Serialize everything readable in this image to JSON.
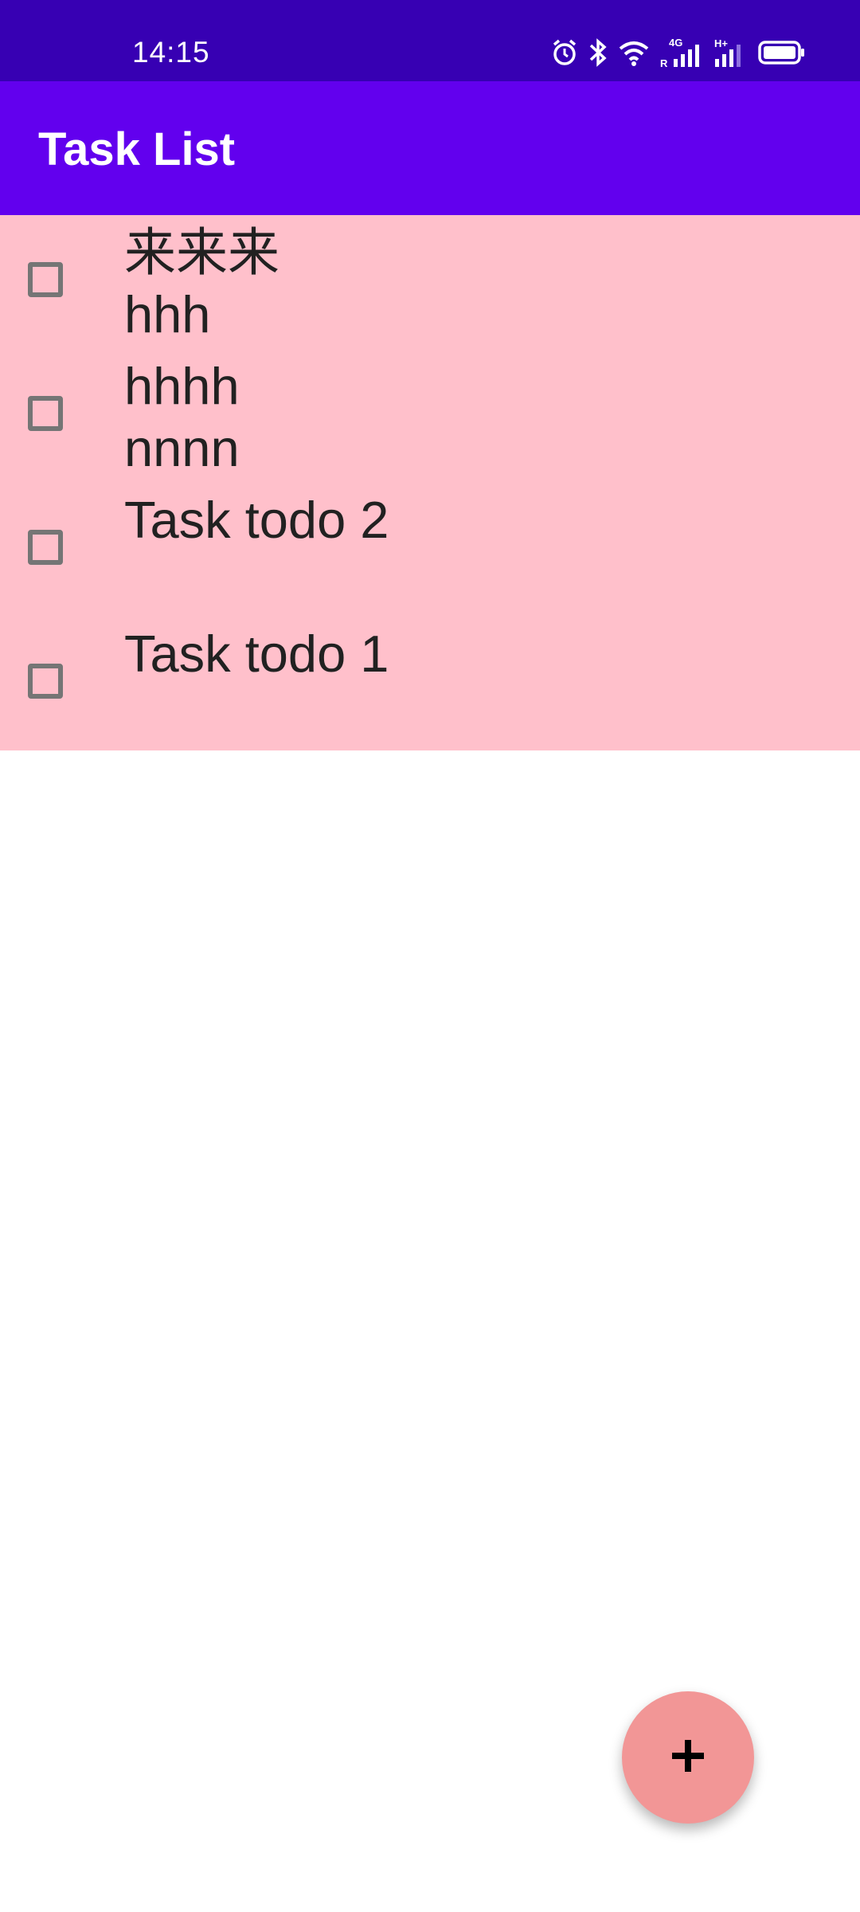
{
  "status_bar": {
    "time": "14:15",
    "icons": [
      "alarm-icon",
      "bluetooth-icon",
      "wifi-icon",
      "signal-4g-icon",
      "signal-h-plus-icon",
      "battery-icon"
    ],
    "network_4g_label": "4G",
    "network_r_label": "R",
    "network_hplus_label": "H+"
  },
  "app_bar": {
    "title": "Task List",
    "color": "#6200ee"
  },
  "colors": {
    "status_bar": "#3700b3",
    "list_background": "#ffc0cb",
    "fab": "#f29696",
    "text": "#212121"
  },
  "tasks": [
    {
      "line1": "来来来",
      "line2": "hhh",
      "checked": false
    },
    {
      "line1": "hhhh",
      "line2": "nnnn",
      "checked": false
    },
    {
      "line1": "Task todo 2",
      "line2": "",
      "checked": false
    },
    {
      "line1": "Task todo 1",
      "line2": "",
      "checked": false
    }
  ],
  "fab": {
    "icon": "plus-icon"
  }
}
